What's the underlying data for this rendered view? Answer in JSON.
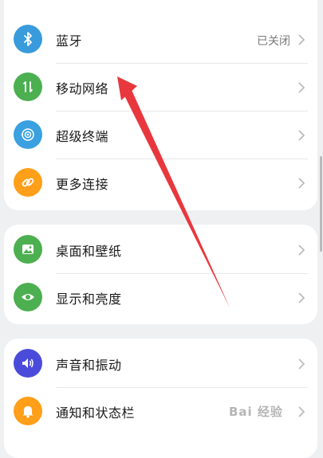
{
  "colors": {
    "bluetooth": "#3a9bdc",
    "mobile_network": "#4caf50",
    "super_device": "#3aa0e0",
    "more_connections": "#ff9f1a",
    "wallpaper": "#4caf50",
    "display": "#4caf50",
    "sound": "#4b4bdb",
    "notifications": "#ff9f1a",
    "arrow": "#e8383d"
  },
  "groups": [
    {
      "items": [
        {
          "label": "蓝牙",
          "status": "已关闭",
          "icon": "bluetooth-icon"
        },
        {
          "label": "移动网络",
          "status": "",
          "icon": "mobile-network-icon"
        },
        {
          "label": "超级终端",
          "status": "",
          "icon": "super-device-icon"
        },
        {
          "label": "更多连接",
          "status": "",
          "icon": "link-icon"
        }
      ]
    },
    {
      "items": [
        {
          "label": "桌面和壁纸",
          "icon": "wallpaper-icon"
        },
        {
          "label": "显示和亮度",
          "icon": "eye-icon"
        }
      ]
    },
    {
      "items": [
        {
          "label": "声音和振动",
          "icon": "speaker-icon"
        },
        {
          "label": "通知和状态栏",
          "icon": "bell-icon"
        }
      ]
    }
  ],
  "watermark": "Bai 经验"
}
